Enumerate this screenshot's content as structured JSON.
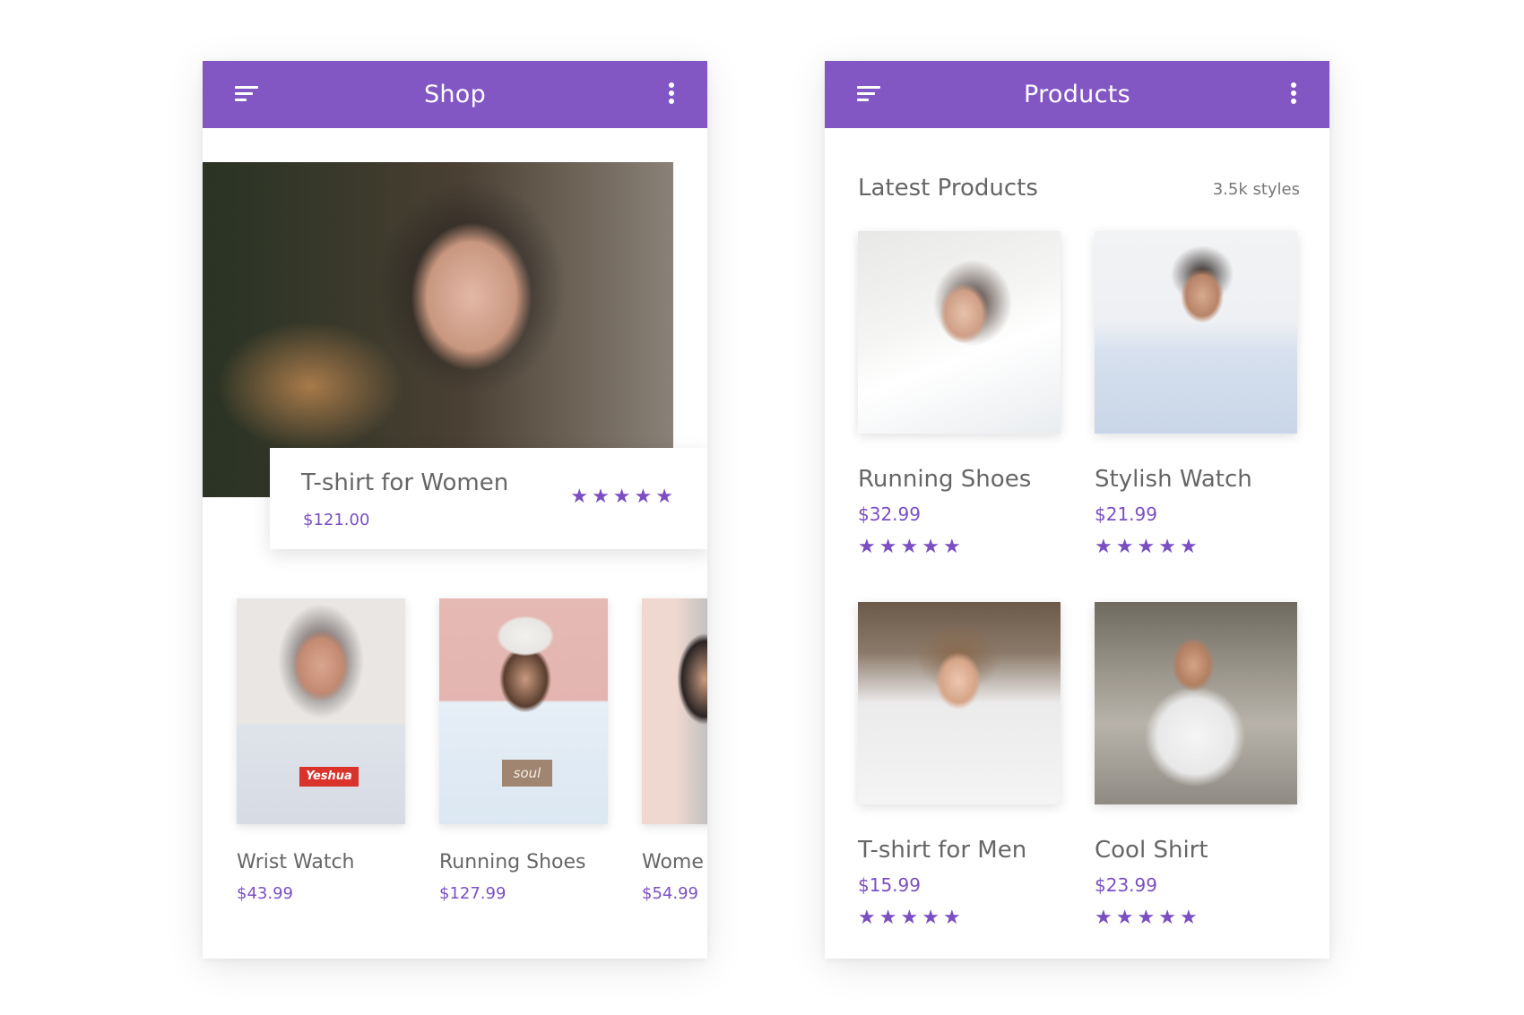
{
  "shop": {
    "title": "Shop",
    "featured": {
      "title": "T-shirt for Women",
      "price": "$121.00",
      "rating": 5,
      "image": "woman-with-glasses"
    },
    "items": [
      {
        "title": "Wrist Watch",
        "price": "$43.99",
        "image": "woman-yeshua-tshirt"
      },
      {
        "title": "Running Shoes",
        "price": "$127.99",
        "image": "man-white-hoodie-cap"
      },
      {
        "title": "Wome",
        "price": "$54.99",
        "image": "person-grey-hoodie"
      }
    ]
  },
  "products": {
    "title": "Products",
    "section_title": "Latest Products",
    "count_label": "3.5k styles",
    "items": [
      {
        "title": "Running Shoes",
        "price": "$32.99",
        "rating": 5,
        "image": "woman-lying-white-sweater"
      },
      {
        "title": "Stylish Watch",
        "price": "$21.99",
        "rating": 5,
        "image": "man-sunglasses-blue-shirt"
      },
      {
        "title": "T-shirt for Men",
        "price": "$15.99",
        "rating": 5,
        "image": "woman-cat-eye-sunglasses"
      },
      {
        "title": "Cool Shirt",
        "price": "$23.99",
        "rating": 5,
        "image": "man-white-tshirt-sitting"
      }
    ]
  },
  "icons": {
    "menu": "menu-lines-icon",
    "more": "more-vertical-icon",
    "star": "star-icon"
  },
  "colors": {
    "accent": "#8257c4",
    "price": "#7b4fc2",
    "star": "#7b4fc2",
    "text": "#666666"
  }
}
